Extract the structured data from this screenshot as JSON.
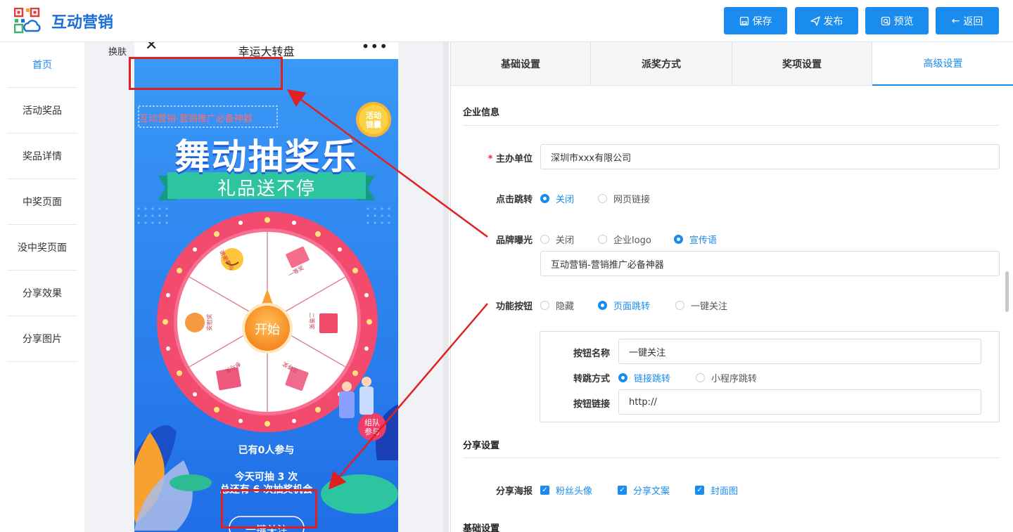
{
  "app": {
    "title": "互动营销"
  },
  "toolbar": {
    "save": "保存",
    "publish": "发布",
    "preview": "预览",
    "back": "返回"
  },
  "sidebar": {
    "items": [
      "首页",
      "活动奖品",
      "奖品详情",
      "中奖页面",
      "没中奖页面",
      "分享效果",
      "分享图片"
    ]
  },
  "canvas": {
    "skin": "换肤"
  },
  "phone": {
    "nav_title": "幸运大转盘",
    "brand_slogan": "互动营销-营销推广必备神器",
    "bag_badge": [
      "活动",
      "锦囊"
    ],
    "main_title": "舞动抽奖乐",
    "ribbon": "礼品送不停",
    "wheel_start": "开始",
    "prizes": [
      "谢谢参与",
      "一等奖",
      "二等奖",
      "三等奖",
      "参与奖",
      "安慰奖"
    ],
    "participants": "已有0人参与",
    "draws_line1": "今天可抽 3 次",
    "draws_line2": "总还有 6 次抽奖机会",
    "team_badge": [
      "组队",
      "参与"
    ],
    "follow_button": "一键关注"
  },
  "tabs": [
    "基础设置",
    "派奖方式",
    "奖项设置",
    "高级设置"
  ],
  "form": {
    "company_section": "企业信息",
    "organizer_label": "主办单位",
    "organizer_value": "深圳市xxx有限公司",
    "click_jump_label": "点击跳转",
    "click_jump_options": [
      "关闭",
      "网页链接"
    ],
    "brand_label": "品牌曝光",
    "brand_options": [
      "关闭",
      "企业logo",
      "宣传语"
    ],
    "brand_value": "互动营销-营销推广必备神器",
    "func_label": "功能按钮",
    "func_options": [
      "隐藏",
      "页面跳转",
      "一键关注"
    ],
    "btn_name_label": "按钮名称",
    "btn_name_value": "一键关注",
    "jump_mode_label": "转跳方式",
    "jump_mode_options": [
      "链接跳转",
      "小程序跳转"
    ],
    "btn_link_label": "按钮链接",
    "btn_link_value": "http://",
    "share_section": "分享设置",
    "poster_label": "分享海报",
    "poster_options": [
      "粉丝头像",
      "分享文案",
      "封面图"
    ],
    "basic_section": "基础设置"
  },
  "colors": {
    "accent": "#1a8cf0",
    "annotation": "#e02020",
    "phone_bg": "#2f8cf2",
    "wheel_rim": "#ec4a6c"
  }
}
